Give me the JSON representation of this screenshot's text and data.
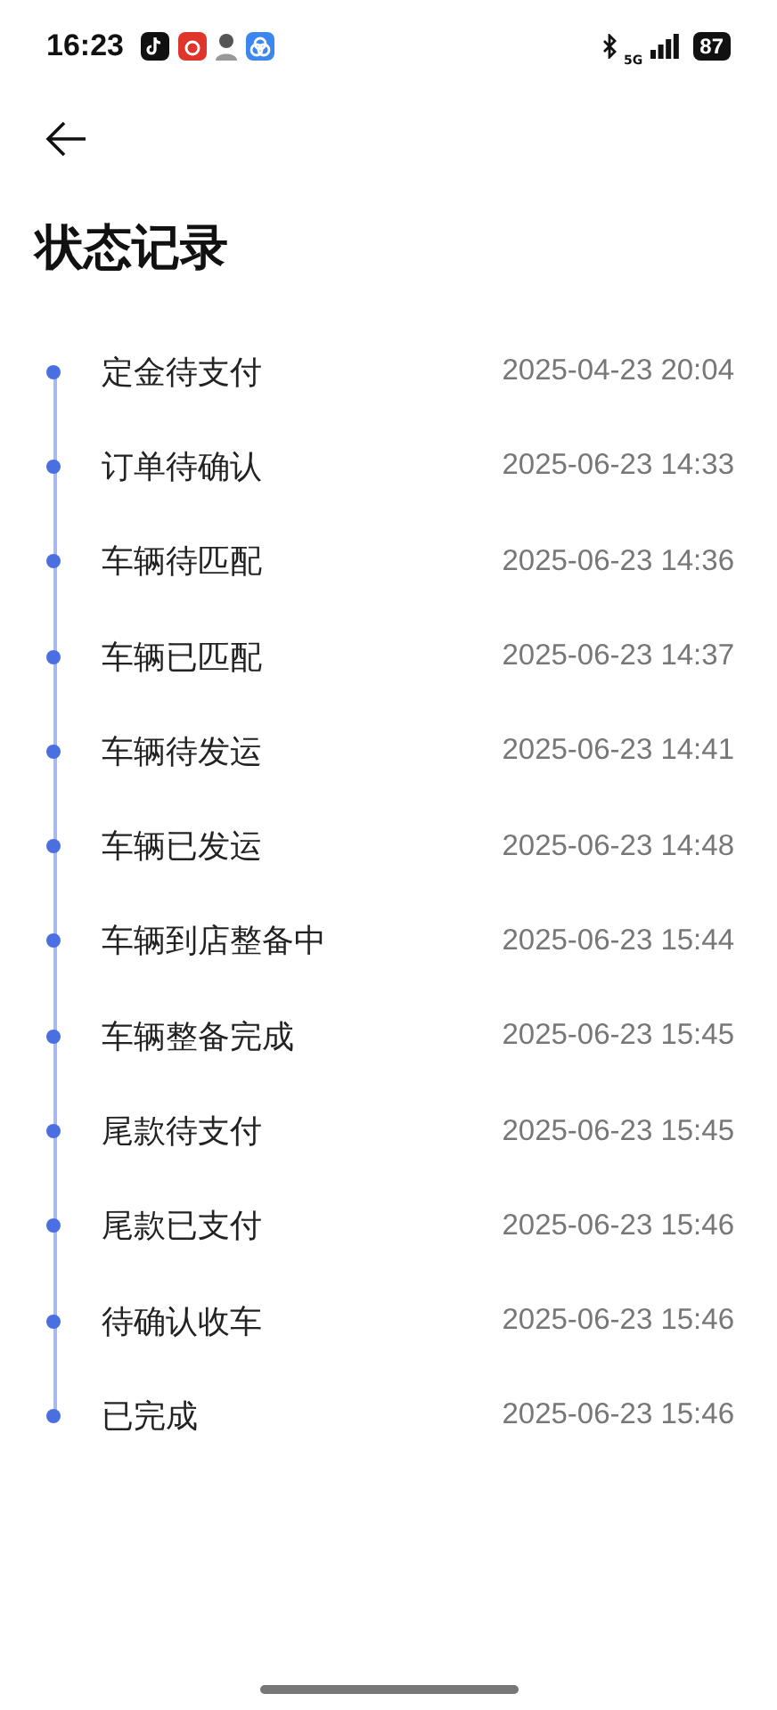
{
  "status_bar": {
    "time": "16:23",
    "network": "5G",
    "battery": "87"
  },
  "title": "状态记录",
  "records": [
    {
      "status": "定金待支付",
      "time": "2025-04-23 20:04"
    },
    {
      "status": "订单待确认",
      "time": "2025-06-23 14:33"
    },
    {
      "status": "车辆待匹配",
      "time": "2025-06-23 14:36"
    },
    {
      "status": "车辆已匹配",
      "time": "2025-06-23 14:37"
    },
    {
      "status": "车辆待发运",
      "time": "2025-06-23 14:41"
    },
    {
      "status": "车辆已发运",
      "time": "2025-06-23 14:48"
    },
    {
      "status": "车辆到店整备中",
      "time": "2025-06-23 15:44"
    },
    {
      "status": "车辆整备完成",
      "time": "2025-06-23 15:45"
    },
    {
      "status": "尾款待支付",
      "time": "2025-06-23 15:45"
    },
    {
      "status": "尾款已支付",
      "time": "2025-06-23 15:46"
    },
    {
      "status": "待确认收车",
      "time": "2025-06-23 15:46"
    },
    {
      "status": "已完成",
      "time": "2025-06-23 15:46"
    }
  ]
}
